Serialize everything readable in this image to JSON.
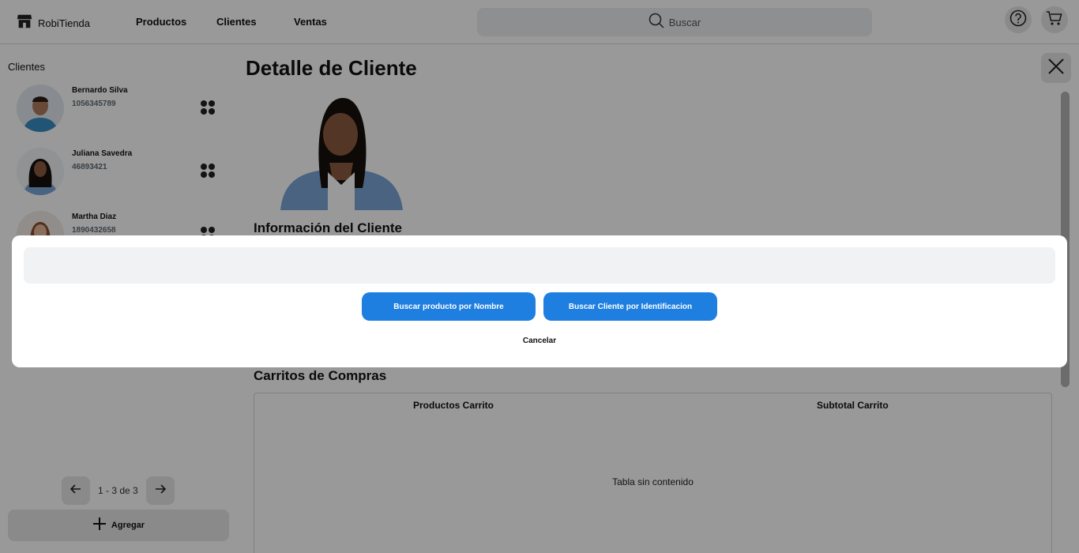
{
  "topbar": {
    "brand": "RobiTienda",
    "nav": [
      "Productos",
      "Clientes",
      "Ventas"
    ],
    "search_label": "Buscar"
  },
  "sidebar": {
    "title": "Clientes",
    "clients": [
      {
        "name": "Bernardo Silva",
        "id": "1056345789"
      },
      {
        "name": "Juliana Savedra",
        "id": "46893421"
      },
      {
        "name": "Martha Diaz",
        "id": "1890432658"
      }
    ],
    "pagination": "1 - 3 de 3",
    "add_label": "Agregar"
  },
  "detail": {
    "title": "Detalle de Cliente",
    "info_title": "Información del Cliente",
    "carts_title": "Carritos de Compras",
    "table": {
      "columns": [
        "Productos Carrito",
        "Subtotal Carrito"
      ],
      "empty_message": "Tabla sin contenido"
    }
  },
  "modal": {
    "input_value": "",
    "buttons": [
      "Buscar producto por Nombre",
      "Buscar Cliente por Identificacion"
    ],
    "cancel_label": "Cancelar"
  },
  "colors": {
    "primary": "#1e7fe0",
    "overlay": "rgba(0,0,0,0.40)",
    "input_bg": "#f0f2f3"
  }
}
